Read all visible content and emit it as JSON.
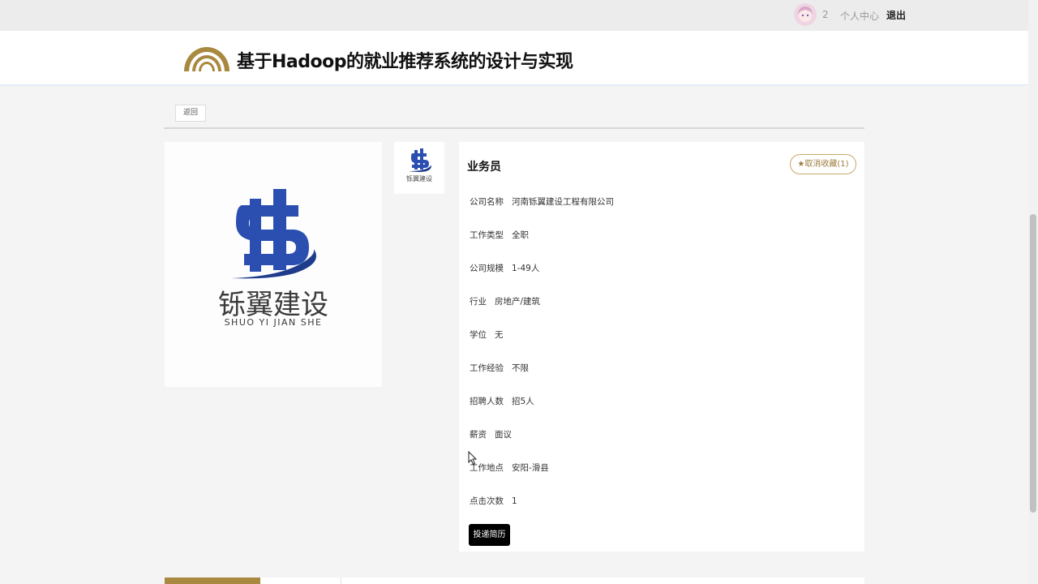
{
  "topbar": {
    "username": "2",
    "user_center": "个人中心",
    "logout": "退出"
  },
  "header": {
    "title": "基于Hadoop的就业推荐系统的设计与实现"
  },
  "back_button": "返回",
  "company_logo": {
    "cn": "铄翼建设",
    "en": "SHUO YI JIAN SHE",
    "accent_color": "#2a4fb0"
  },
  "job": {
    "title": "业务员",
    "favorite_label": "★取消收藏(1)",
    "fields": [
      {
        "label": "公司名称",
        "value": "河南铄翼建设工程有限公司"
      },
      {
        "label": "工作类型",
        "value": "全职"
      },
      {
        "label": "公司规模",
        "value": "1-49人"
      },
      {
        "label": "行业",
        "value": "房地产/建筑"
      },
      {
        "label": "学位",
        "value": "无"
      },
      {
        "label": "工作经验",
        "value": "不限"
      },
      {
        "label": "招聘人数",
        "value": "招5人"
      },
      {
        "label": "薪资",
        "value": "面议"
      },
      {
        "label": "工作地点",
        "value": "安阳-滑县"
      },
      {
        "label": "点击次数",
        "value": "1"
      }
    ],
    "apply_label": "投递简历"
  },
  "colors": {
    "brand_gold": "#a8893f",
    "logo_blue": "#2a4fb0"
  }
}
